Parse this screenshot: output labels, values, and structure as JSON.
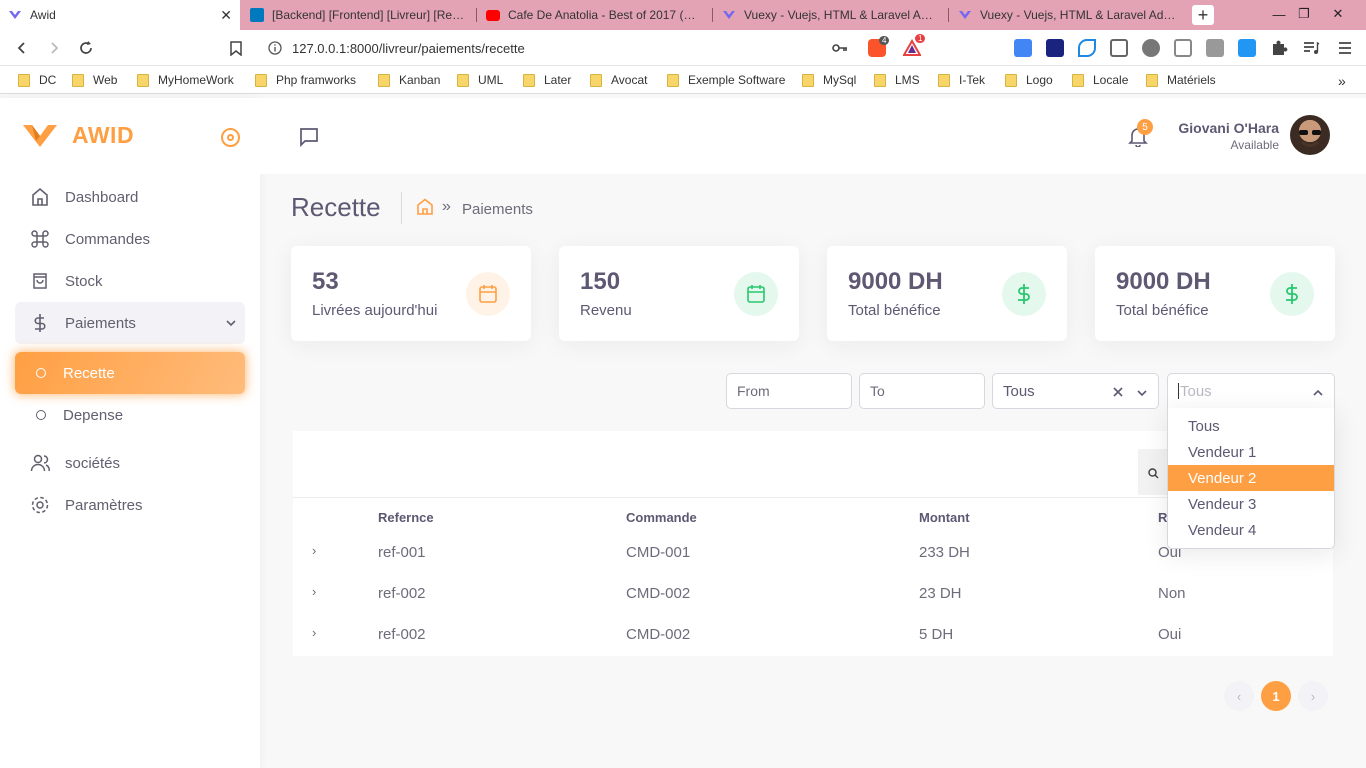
{
  "browser": {
    "tabs": [
      {
        "title": "Awid",
        "active": true
      },
      {
        "title": "[Backend] [Frontend] [Livreur] [Recette"
      },
      {
        "title": "Cafe De Anatolia - Best of 2017 (Mix b"
      },
      {
        "title": "Vuexy - Vuejs, HTML & Laravel Admin"
      },
      {
        "title": "Vuexy - Vuejs, HTML & Laravel Admin"
      }
    ],
    "url": "127.0.0.1:8000/livreur/paiements/recette",
    "ext_badge_1": "4",
    "ext_badge_2": "1",
    "bookmarks": [
      "DC",
      "Web",
      "MyHomeWork",
      "Php framworks",
      "Kanban",
      "UML",
      "Later",
      "Avocat",
      "Exemple Software",
      "MySql",
      "LMS",
      "I-Tek",
      "Logo",
      "Locale",
      "Matériels"
    ]
  },
  "app": {
    "brand": "AWID",
    "accent": "#ff9f43",
    "nav": [
      {
        "label": "Dashboard",
        "icon": "home-icon"
      },
      {
        "label": "Commandes",
        "icon": "command-icon"
      },
      {
        "label": "Stock",
        "icon": "shopping-bag-icon"
      },
      {
        "label": "Paiements",
        "icon": "dollar-icon"
      },
      {
        "label": "Recette",
        "icon": "circle-icon"
      },
      {
        "label": "Depense",
        "icon": "circle-icon"
      },
      {
        "label": "sociétés",
        "icon": "users-icon"
      },
      {
        "label": "Paramètres",
        "icon": "settings-icon"
      }
    ]
  },
  "header": {
    "notification_count": "5",
    "user_name": "Giovani O'Hara",
    "user_status": "Available"
  },
  "content": {
    "title": "Recette",
    "breadcrumb_current": "Paiements",
    "stats": [
      {
        "value": "53",
        "label": "Livrées aujourd'hui",
        "icon": "calendar-icon",
        "color": "#ff9f43"
      },
      {
        "value": "150",
        "label": "Revenu",
        "icon": "calendar-icon",
        "color": "#28c76f"
      },
      {
        "value": "9000 DH",
        "label": "Total bénéfice",
        "icon": "dollar-icon",
        "color": "#28c76f"
      },
      {
        "value": "9000 DH",
        "label": "Total bénéfice",
        "icon": "dollar-icon",
        "color": "#28c76f"
      }
    ],
    "filters": {
      "from_placeholder": "From",
      "to_placeholder": "To",
      "select1_value": "Tous",
      "select2_placeholder": "Tous",
      "select2_options": [
        "Tous",
        "Vendeur 1",
        "Vendeur 2",
        "Vendeur 3",
        "Vendeur 4"
      ],
      "select2_highlighted": "Vendeur 2"
    },
    "table": {
      "columns": [
        "Refernce",
        "Commande",
        "Montant",
        "R"
      ],
      "rows": [
        [
          "ref-001",
          "CMD-001",
          "233 DH",
          "Oui"
        ],
        [
          "ref-002",
          "CMD-002",
          "23 DH",
          "Non"
        ],
        [
          "ref-002",
          "CMD-002",
          "5 DH",
          "Oui"
        ]
      ]
    },
    "pagination": {
      "current": "1",
      "prev": "‹",
      "next": "›"
    }
  }
}
